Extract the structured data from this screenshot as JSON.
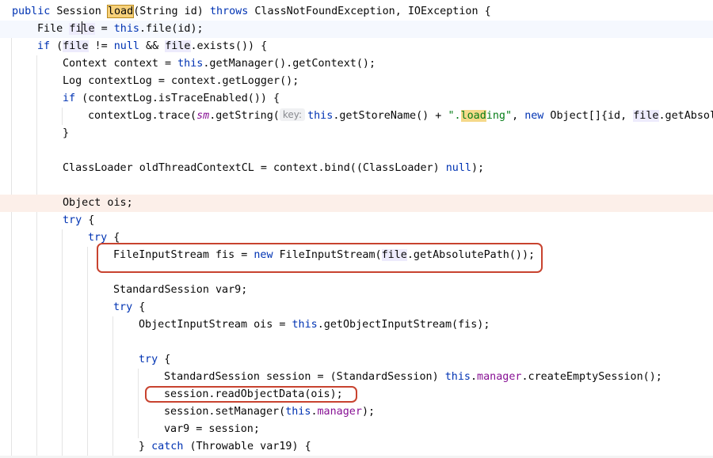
{
  "code": {
    "l1": {
      "kw_public": "public",
      "t1": " Session ",
      "method": "load",
      "t2": "(String id) ",
      "kw_throws": "throws",
      "t3": " ClassNotFoundException, IOException {"
    },
    "l2": {
      "t1": "File ",
      "var_a": "fi",
      "var_b": "le",
      "t2": " = ",
      "kw_this": "this",
      "t3": ".file(id);"
    },
    "l3": {
      "kw_if": "if",
      "t1": " (",
      "var1": "file",
      "t2": " != ",
      "kw_null": "null",
      "t3": " && ",
      "var2": "file",
      "t4": ".exists()) {"
    },
    "l4": {
      "t1": "Context context = ",
      "kw_this": "this",
      "t2": ".getManager().getContext();"
    },
    "l5": {
      "t1": "Log contextLog = context.getLogger();"
    },
    "l6": {
      "kw_if": "if",
      "t1": " (contextLog.isTraceEnabled()) {"
    },
    "l7": {
      "t1": "contextLog.trace(",
      "static_field": "sm",
      "t2": ".getString(",
      "hint": "key:",
      "kw_this": "this",
      "t3": ".getStoreName() + ",
      "str_a": "\".",
      "str_match": "load",
      "str_b": "ing\"",
      "t4": ", ",
      "kw_new": "new",
      "t5": " Object[]{id, ",
      "var": "file",
      "t6": ".getAbsol"
    },
    "l8": {
      "t1": "}"
    },
    "l9": {
      "t1": "ClassLoader oldThreadContextCL = context.bind((ClassLoader) ",
      "kw_null": "null",
      "t2": ");"
    },
    "l10": {
      "t1": "Object ois;"
    },
    "l11": {
      "kw_try": "try",
      "t1": " {"
    },
    "l12": {
      "kw_try": "try",
      "t1": " {"
    },
    "l13": {
      "t1": "FileInputStream fis = ",
      "kw_new": "new",
      "t2": " FileInputStream(",
      "var": "file",
      "t3": ".getAbsolutePath());"
    },
    "l14": {
      "t1": "StandardSession var9;"
    },
    "l15": {
      "kw_try": "try",
      "t1": " {"
    },
    "l16": {
      "t1": "ObjectInputStream ois = ",
      "kw_this": "this",
      "t2": ".getObjectInputStream(fis);"
    },
    "l17": {
      "kw_try": "try",
      "t1": " {"
    },
    "l18": {
      "t1": "StandardSession session = (StandardSession) ",
      "kw_this": "this",
      "t2": ".",
      "fld": "manager",
      "t3": ".createEmptySession();"
    },
    "l19": {
      "t1": "session.readObjectData(ois);"
    },
    "l20": {
      "t1": "session.setManager(",
      "kw_this": "this",
      "t2": ".",
      "fld": "manager",
      "t3": ");"
    },
    "l21": {
      "t1": "var9 = session;"
    },
    "l22": {
      "t1": "} ",
      "kw_catch": "catch",
      "t2": " (Throwable var19) {"
    }
  },
  "colors": {
    "keyword": "#0033b3",
    "field": "#871094",
    "string": "#067d17",
    "annotation_box": "#c8432f",
    "search_highlight": "#f5d98a",
    "usage_highlight": "#edebfc",
    "caret_line": "#f5f8fe",
    "highlighted_line": "#fcefe9"
  }
}
